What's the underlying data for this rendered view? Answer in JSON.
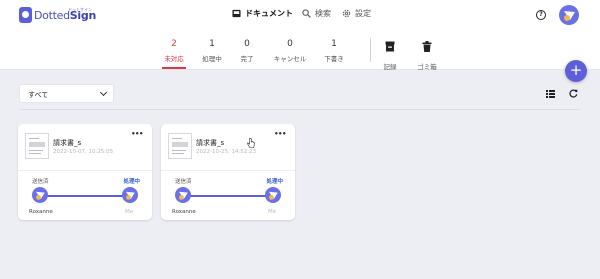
{
  "app": {
    "logo_text_a": "Dotted",
    "logo_text_b": "Sign",
    "logo_kana": "ドットサイン"
  },
  "nav": {
    "documents": "ドキュメント",
    "search": "検索",
    "settings": "設定"
  },
  "help_glyph": "?",
  "stats": [
    {
      "count": "2",
      "label": "未対応"
    },
    {
      "count": "1",
      "label": "処理中"
    },
    {
      "count": "0",
      "label": "完了"
    },
    {
      "count": "0",
      "label": "キャンセル"
    },
    {
      "count": "1",
      "label": "下書き"
    }
  ],
  "tools": {
    "records": "記録",
    "trash": "ゴミ箱"
  },
  "fab_glyph": "+",
  "filter": {
    "selected": "すべて"
  },
  "documents": [
    {
      "title": "請求書_s",
      "date": "2022-10-07, 10:25:05",
      "from_status": "送信済",
      "to_status": "処理中",
      "from_name": "Roxanne",
      "to_name": "Me"
    },
    {
      "title": "請求書_s",
      "date": "2022-10-25, 14:52:23",
      "from_status": "送信済",
      "to_status": "処理中",
      "from_name": "Roxanne",
      "to_name": "Me"
    }
  ],
  "more_glyph": "•••",
  "colors": {
    "accent": "#5b60d9",
    "active_tab": "#d83a48",
    "status_blue": "#3a5fd6",
    "background": "#eceef3"
  },
  "icons": [
    "document-tray-icon",
    "search-icon",
    "gear-icon",
    "help-icon",
    "user-avatar-icon",
    "archive-box-icon",
    "trash-icon",
    "plus-icon",
    "chevron-down-icon",
    "list-view-icon",
    "refresh-icon",
    "more-icon",
    "pointer-cursor-icon"
  ]
}
